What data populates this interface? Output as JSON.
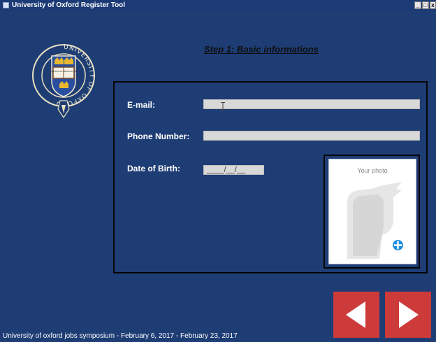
{
  "window": {
    "title": "University of Oxford Register Tool",
    "controls": [
      "minimize",
      "maximize",
      "close"
    ]
  },
  "branding": {
    "crest_text": "UNIVERSITY OF OXFORD",
    "book_text": "DOMINUS ILLUMINATIO MEA"
  },
  "step": {
    "title": "Step 1:  Basic informations"
  },
  "form": {
    "fields": [
      {
        "label": "E-mail:",
        "value": ""
      },
      {
        "label": "Phone Number:",
        "value": ""
      },
      {
        "label": "Date of Birth:",
        "value": "____/__/__"
      }
    ]
  },
  "photo": {
    "label": "Your photo",
    "add_icon": "plus-icon"
  },
  "nav": {
    "prev_icon": "arrow-left-icon",
    "next_icon": "arrow-right-icon"
  },
  "footer": {
    "text": "University of oxford jobs symposium  -  February 6, 2017 - February 23, 2017"
  },
  "colors": {
    "background": "#1e3d75",
    "nav_button": "#cc3b3a",
    "add_button": "#1e8fe0"
  }
}
